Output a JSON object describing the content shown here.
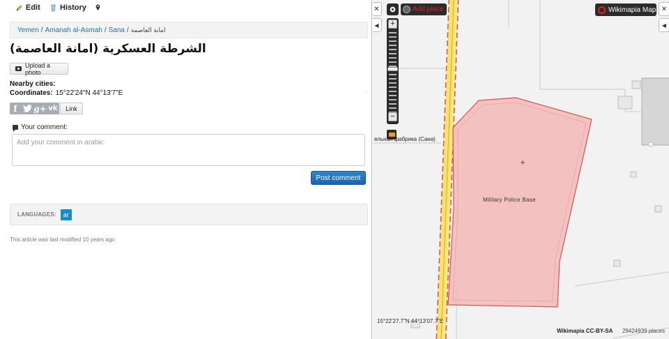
{
  "topbar": {
    "edit_label": "Edit",
    "history_label": "History"
  },
  "breadcrumb": {
    "items": [
      "Yemen",
      "Amanah al-Asmah",
      "Sana"
    ],
    "current": "امانة العاصمة"
  },
  "title": "الشرطة العسكرية (امانة العاصمة)",
  "upload_photo_label": "Upload a photo",
  "nearby_cities_label": "Nearby cities:",
  "coordinates": {
    "label": "Coordinates:",
    "value": "15°22'24\"N 44°13'7\"E"
  },
  "share": {
    "icons": [
      "facebook-icon",
      "twitter-icon",
      "googleplus-icon",
      "vk-icon"
    ],
    "link_label": "Link"
  },
  "comment": {
    "label": "Your comment:",
    "placeholder": "Add your comment in arabic",
    "post_label": "Post comment"
  },
  "languages": {
    "label": "LANGUAGES:",
    "items": [
      "ar"
    ]
  },
  "last_modified": "This article was last modified 10 years ago",
  "map": {
    "add_place_label": "Add place",
    "brand_label": "Wikimapia Map",
    "poi_label": "Military Police Base",
    "street_label": "ельная фабрика (Сана)",
    "coordinate_readout": "15°22'27.7\"N 44°13'07.7\"E",
    "credit": "Wikimapia CC-BY-SA",
    "places_count": "29424939 places",
    "colors": {
      "polygon_fill": "#f4b8b8",
      "polygon_stroke": "#d9534f",
      "road_yellow": "#f5e36a",
      "road_red": "#e05050"
    }
  }
}
